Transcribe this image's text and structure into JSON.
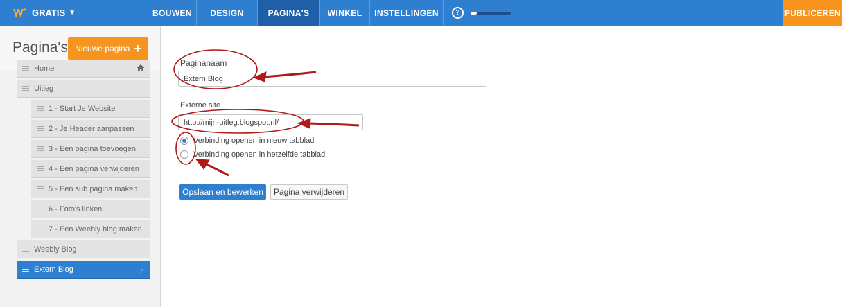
{
  "topbar": {
    "plan_label": "GRATIS",
    "tabs": [
      {
        "label": "BOUWEN",
        "active": false
      },
      {
        "label": "DESIGN",
        "active": false
      },
      {
        "label": "PAGINA'S",
        "active": true
      },
      {
        "label": "WINKEL",
        "active": false
      },
      {
        "label": "INSTELLINGEN",
        "active": false
      }
    ],
    "help_symbol": "?",
    "setup_progress": 0.15,
    "publish_label": "PUBLICEREN",
    "colors": {
      "bar": "#2f7fd0",
      "active_tab": "#1f5fa8",
      "publish": "#f7941d",
      "logo": "#f7a928"
    }
  },
  "sidebar": {
    "title": "Pagina's",
    "new_page_label": "Nieuwe pagina",
    "new_page_icon": "plus-icon",
    "pages": [
      {
        "label": "Home",
        "level": 0,
        "icon": "home-icon",
        "active": false
      },
      {
        "label": "Uitleg",
        "level": 0,
        "active": false
      },
      {
        "label": "1 - Start Je Website",
        "level": 1,
        "active": false
      },
      {
        "label": "2 - Je Header aanpassen",
        "level": 1,
        "active": false
      },
      {
        "label": "3 - Een pagina toevoegen",
        "level": 1,
        "active": false
      },
      {
        "label": "4 - Een pagina verwijderen",
        "level": 1,
        "active": false
      },
      {
        "label": "5 - Een sub pagina maken",
        "level": 1,
        "active": false
      },
      {
        "label": "6 - Foto's linken",
        "level": 1,
        "active": false
      },
      {
        "label": "7 - Een Weebly blog maken",
        "level": 1,
        "active": false
      },
      {
        "label": "Weebly Blog",
        "level": 0,
        "active": false
      },
      {
        "label": "Extern Blog",
        "level": 0,
        "icon": "external-link-icon",
        "active": true
      }
    ]
  },
  "form": {
    "name_label": "Paginanaam",
    "name_value": "Extern Blog",
    "external_label": "Externe site",
    "external_value": "http://mijn-uitleg.blogspot.nl/",
    "radio_options": [
      {
        "label": "Verbinding openen in nieuw tabblad",
        "checked": true
      },
      {
        "label": "Verbinding openen in hetzelfde tabblad",
        "checked": false
      }
    ],
    "save_label": "Opslaan en bewerken",
    "delete_label": "Pagina verwijderen"
  },
  "annotation_color": "#b01818"
}
